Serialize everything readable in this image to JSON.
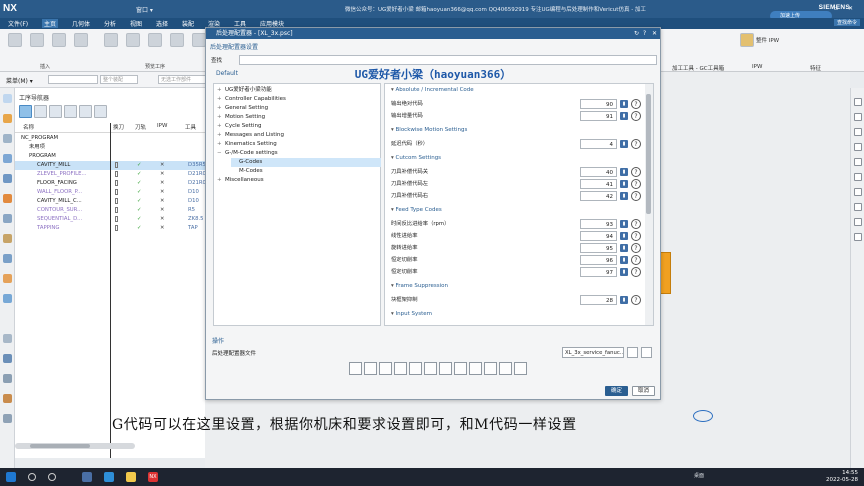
{
  "app": {
    "logo": "NX",
    "window_title": "微信公众号：UG爱好者小梁  邮箱haoyuan366@qq.com  QQ406592919  专注UG编程与后处理制作和Vericut仿真 - 加工",
    "quick_access": "窗口 ▾",
    "brand": "SIEMENS",
    "share_button": "加速上传"
  },
  "menubar": {
    "items": [
      "文件(F)",
      "主页",
      "几何体",
      "分析",
      "视图",
      "选择",
      "装配",
      "渲染",
      "工具",
      "应用模块"
    ],
    "active": "主页",
    "search": "查找命令"
  },
  "ribbon": {
    "groups": [
      "插入",
      "预览工序"
    ],
    "right_labels": [
      "整件 IPW",
      "加工工具 - GC工具箱",
      "IPW",
      "特征"
    ]
  },
  "toolbar2": {
    "menu_label": "菜单(M) ▾",
    "filter_placeholder": "",
    "assembly_placeholder": "整个装配",
    "part_placeholder": "无选工作部件"
  },
  "navigator": {
    "title": "工序导航器",
    "columns": [
      "名称",
      "换刀",
      "刀轨",
      "IPW",
      "工具"
    ],
    "rows": [
      {
        "name": "NC_PROGRAM",
        "tool": "",
        "check": "",
        "ipw": "",
        "indent": 0
      },
      {
        "name": "未用项",
        "tool": "",
        "check": "",
        "ipw": "",
        "indent": 1
      },
      {
        "name": "PROGRAM",
        "tool": "",
        "check": "",
        "ipw": "",
        "indent": 1
      },
      {
        "name": "CAVITY_MILL",
        "tool": "D35R5",
        "check": "✓",
        "ipw": "✕",
        "indent": 2,
        "selected": true
      },
      {
        "name": "ZLEVEL_PROFILE...",
        "tool": "D21R0.8",
        "check": "✓",
        "ipw": "✕",
        "indent": 2
      },
      {
        "name": "FLOOR_FACING",
        "tool": "D21R0.8",
        "check": "✓",
        "ipw": "✕",
        "indent": 2
      },
      {
        "name": "WALL_FLOOR_P...",
        "tool": "D10",
        "check": "✓",
        "ipw": "✕",
        "indent": 2
      },
      {
        "name": "CAVITY_MILL_C...",
        "tool": "D10",
        "check": "✓",
        "ipw": "✕",
        "indent": 2
      },
      {
        "name": "CONTOUR_SUR...",
        "tool": "R5",
        "check": "✓",
        "ipw": "✕",
        "indent": 2
      },
      {
        "name": "SEQUENTIAL_D...",
        "tool": "ZK8.5",
        "check": "✓",
        "ipw": "✕",
        "indent": 2
      },
      {
        "name": "TAPPING",
        "tool": "TAP",
        "check": "✓",
        "ipw": "✕",
        "indent": 2
      }
    ]
  },
  "dialog": {
    "title": "后处理配置器 - [XL_3x.psc]",
    "section_settings": "后处理配置器设置",
    "file_label": "查找",
    "banner": "UG爱好者小梁（haoyuan366）",
    "default_label": "Default",
    "tree": [
      {
        "label": "UG爱好者小梁功能",
        "indent": 0,
        "toggle": "+"
      },
      {
        "label": "Controller Capabilities",
        "indent": 0,
        "toggle": "+"
      },
      {
        "label": "General Setting",
        "indent": 0,
        "toggle": "+"
      },
      {
        "label": "Motion Setting",
        "indent": 0,
        "toggle": "+"
      },
      {
        "label": "Cycle Setting",
        "indent": 0,
        "toggle": "+"
      },
      {
        "label": "Messages and Listing",
        "indent": 0,
        "toggle": "+"
      },
      {
        "label": "Kinematics Setting",
        "indent": 0,
        "toggle": "+"
      },
      {
        "label": "G-/M-Code settings",
        "indent": 0,
        "toggle": "−"
      },
      {
        "label": "G-Codes",
        "indent": 1,
        "toggle": "",
        "selected": true
      },
      {
        "label": "M-Codes",
        "indent": 1,
        "toggle": ""
      },
      {
        "label": "Miscellaneous",
        "indent": 0,
        "toggle": "+"
      }
    ],
    "groups": [
      {
        "title": "Absolute / Incremental Code",
        "rows": [
          {
            "label": "输出绝对代码",
            "value": "90"
          },
          {
            "label": "输出增量代码",
            "value": "91"
          }
        ]
      },
      {
        "title": "Blockwise Motion Settings",
        "rows": [
          {
            "label": "延迟代码（秒）",
            "value": "4"
          }
        ]
      },
      {
        "title": "Cutcom Settings",
        "rows": [
          {
            "label": "刀具补偿代码关",
            "value": "40"
          },
          {
            "label": "刀具补偿代码左",
            "value": "41"
          },
          {
            "label": "刀具补偿代码右",
            "value": "42"
          }
        ]
      },
      {
        "title": "Feed Type Codes",
        "rows": [
          {
            "label": "时间反比进给率（rpm）",
            "value": "93"
          },
          {
            "label": "线性进给率",
            "value": "94"
          },
          {
            "label": "旋转进给率",
            "value": "95"
          },
          {
            "label": "恒定切削率",
            "value": "96"
          },
          {
            "label": "恒定切削率",
            "value": "97"
          }
        ]
      },
      {
        "title": "Frame Suppression",
        "rows": [
          {
            "label": "块框架抑制",
            "value": "28"
          }
        ]
      },
      {
        "title": "Input System",
        "rows": []
      }
    ],
    "operation_title": "操作",
    "operation_label": "后处理配置器文件",
    "post_file": "XL_3x_service_fanuc..",
    "ok": "确定",
    "cancel": "取消"
  },
  "subtitle": "G代码可以在这里设置，根据你机床和要求设置即可，和M代码一样设置",
  "taskbar": {
    "lang": "桌面",
    "time": "14:55",
    "date": "2022-05-28"
  },
  "colors": {
    "title_blue": "#2b5b8a",
    "menu_blue": "#1f4f7d",
    "banner_blue": "#1e58a8",
    "check_green": "#2f9d2f",
    "part_orange": "#f0a020"
  }
}
